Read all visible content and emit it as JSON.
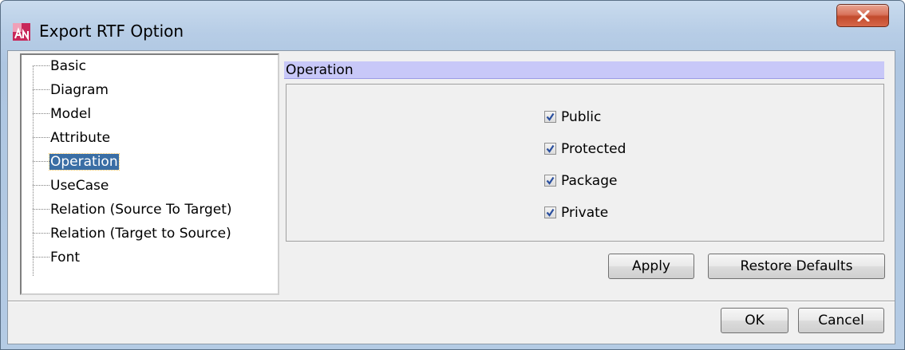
{
  "window": {
    "title": "Export RTF Option"
  },
  "tree": {
    "items": [
      {
        "label": "Basic"
      },
      {
        "label": "Diagram"
      },
      {
        "label": "Model"
      },
      {
        "label": "Attribute"
      },
      {
        "label": "Operation",
        "selected": true
      },
      {
        "label": "UseCase"
      },
      {
        "label": "Relation (Source To Target)"
      },
      {
        "label": "Relation (Target to Source)"
      },
      {
        "label": "Font"
      }
    ]
  },
  "section": {
    "title": "Operation"
  },
  "options": [
    {
      "label": "Public",
      "checked": true
    },
    {
      "label": "Protected",
      "checked": true
    },
    {
      "label": "Package",
      "checked": true
    },
    {
      "label": "Private",
      "checked": true
    }
  ],
  "buttons": {
    "apply": "Apply",
    "restore_defaults": "Restore Defaults",
    "ok": "OK",
    "cancel": "Cancel"
  },
  "colors": {
    "section_header_bg": "#c8c8f8",
    "selection_bg": "#3a6ea5",
    "close_button": "#c24a2c"
  }
}
